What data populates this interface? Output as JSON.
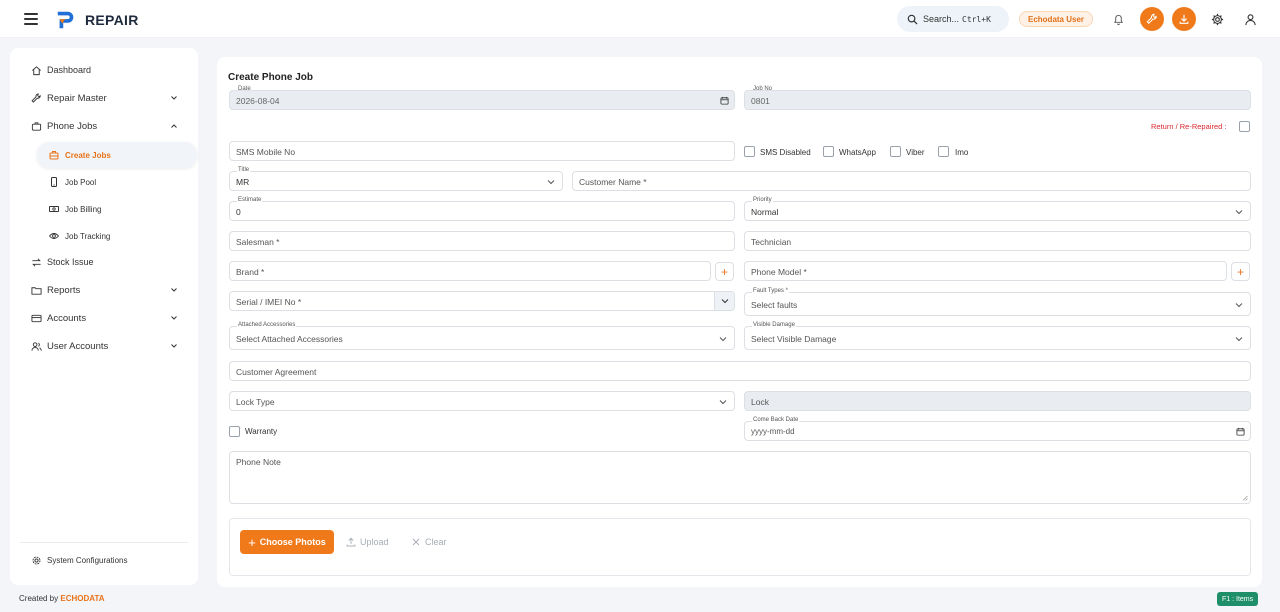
{
  "header": {
    "brand": "REPAIR",
    "search_label": "Search...",
    "search_shortcut": "Ctrl+K",
    "user_name": "Echodata User",
    "accent": "#f07a1a"
  },
  "sidebar": {
    "items": [
      {
        "label": "Dashboard",
        "icon": "home-icon"
      },
      {
        "label": "Repair Master",
        "icon": "wrench-icon"
      },
      {
        "label": "Phone Jobs",
        "icon": "briefcase-icon"
      },
      {
        "label": "Stock Issue",
        "icon": "swap-icon"
      },
      {
        "label": "Reports",
        "icon": "folder-icon"
      },
      {
        "label": "Accounts",
        "icon": "card-icon"
      },
      {
        "label": "User Accounts",
        "icon": "users-icon"
      }
    ],
    "sub_items": [
      {
        "label": "Create Jobs",
        "icon": "briefcase-icon",
        "active": true
      },
      {
        "label": "Job Pool",
        "icon": "phone-icon"
      },
      {
        "label": "Job Billing",
        "icon": "cash-icon"
      },
      {
        "label": "Job Tracking",
        "icon": "eye-icon"
      }
    ],
    "config_label": "System Configurations"
  },
  "form": {
    "title": "Create Phone Job",
    "date_label": "Date",
    "date_value": "2026-08-04",
    "jobno_label": "Job No",
    "jobno_value": "0801",
    "return_label": "Return / Re-Repaired :",
    "sms_placeholder": "SMS Mobile No",
    "sms_disabled_label": "SMS Disabled",
    "whatsapp_label": "WhatsApp",
    "viber_label": "Viber",
    "imo_label": "Imo",
    "title_label": "Title",
    "title_value": "MR",
    "customer_placeholder": "Customer Name *",
    "estimate_label": "Estimate",
    "estimate_value": "0",
    "priority_label": "Priority",
    "priority_value": "Normal",
    "salesman_placeholder": "Salesman *",
    "technician_placeholder": "Technician",
    "brand_placeholder": "Brand *",
    "model_placeholder": "Phone Model *",
    "serial_placeholder": "Serial / IMEI No *",
    "fault_label": "Fault Types *",
    "fault_placeholder": "Select faults",
    "accessories_label": "Attached Accessories",
    "accessories_placeholder": "Select Attached Accessories",
    "damage_label": "Visible Damage",
    "damage_placeholder": "Select Visible Damage",
    "agreement_placeholder": "Customer Agreement",
    "locktype_placeholder": "Lock Type",
    "lock_placeholder": "Lock",
    "warranty_label": "Warranty",
    "comeback_label": "Come Back Date",
    "comeback_placeholder": "yyyy-mm-dd",
    "note_placeholder": "Phone Note",
    "choose_label": "Choose Photos",
    "upload_label": "Upload",
    "clear_label": "Clear"
  },
  "footer": {
    "created_by": "Created by",
    "company": "ECHODATA",
    "shortcut": "F1 : Items"
  }
}
